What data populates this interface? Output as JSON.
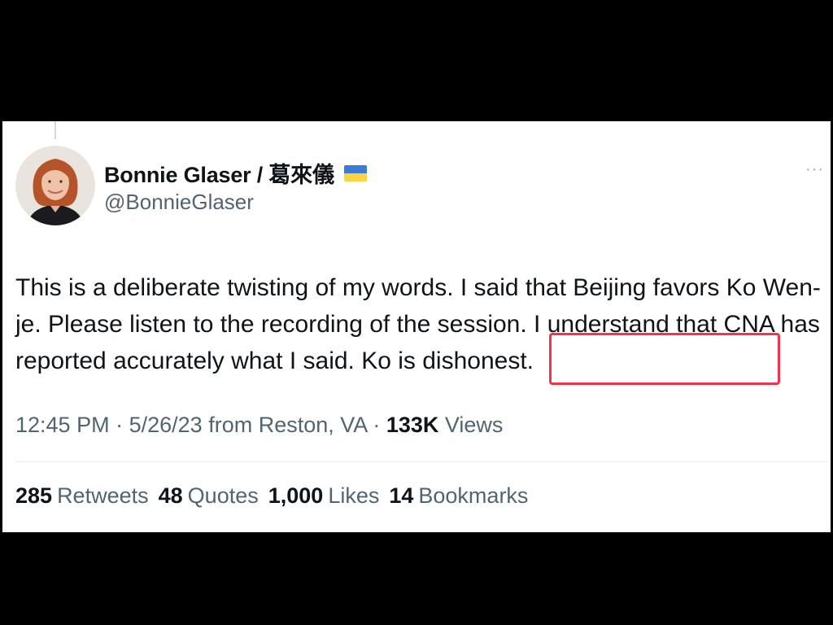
{
  "tweet": {
    "author": {
      "display_name": "Bonnie Glaser / 葛來儀",
      "flag_icon": "ukraine-flag-icon",
      "handle": "@BonnieGlaser"
    },
    "more_icon": "more-options-icon",
    "text": "This is a deliberate twisting of my words. I said that Beijing favors Ko Wen-je. Please listen to the recording of the session. I understand that CNA has reported accurately what I said. Ko is dishonest.",
    "highlighted_phrase": ". Ko is dishonest.",
    "meta": {
      "time": "12:45 PM",
      "date": "5/26/23",
      "location": "from Reston, VA",
      "views_count": "133K",
      "views_label": "Views",
      "separator": "·"
    },
    "stats": [
      {
        "count": "285",
        "label": "Retweets"
      },
      {
        "count": "48",
        "label": "Quotes"
      },
      {
        "count": "1,000",
        "label": "Likes"
      },
      {
        "count": "14",
        "label": "Bookmarks"
      }
    ]
  },
  "colors": {
    "highlight_box": "#f0354a",
    "flag_blue": "#3a7bd5",
    "flag_yellow": "#ffd23f",
    "secondary_text": "#536471",
    "primary_text": "#0f1419"
  }
}
